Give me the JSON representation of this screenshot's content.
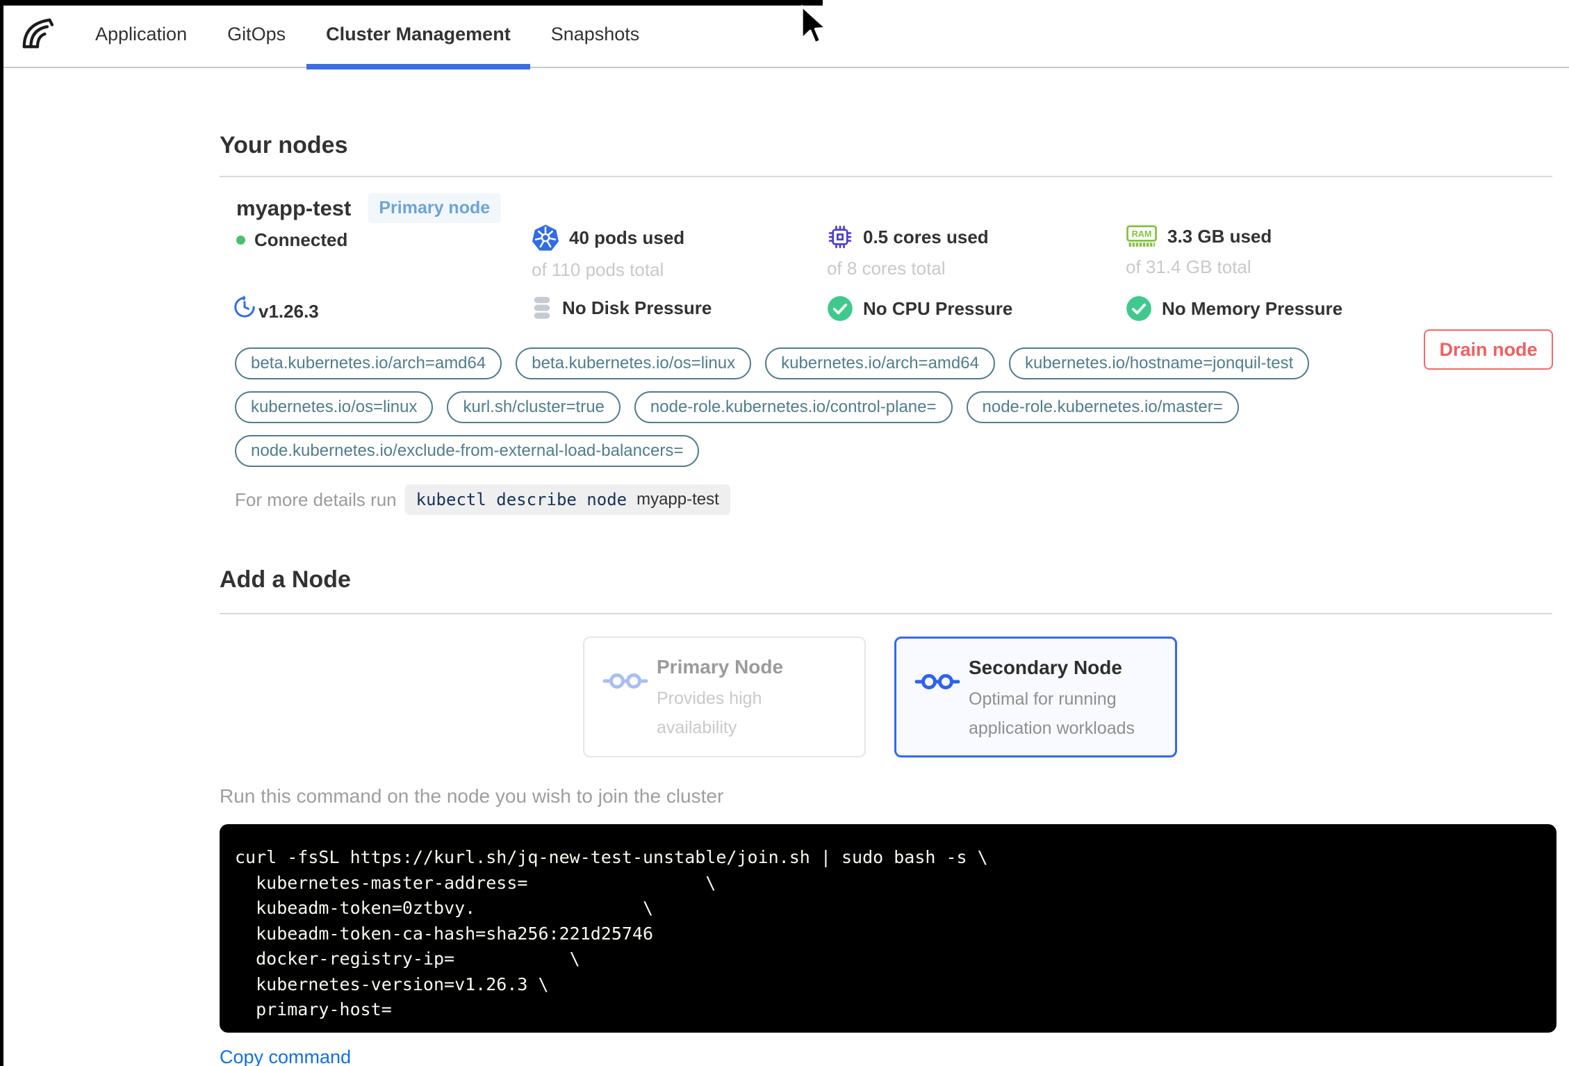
{
  "nav": {
    "tabs": [
      {
        "label": "Application",
        "active": false
      },
      {
        "label": "GitOps",
        "active": false
      },
      {
        "label": "Cluster Management",
        "active": true
      },
      {
        "label": "Snapshots",
        "active": false
      }
    ]
  },
  "nodes": {
    "heading": "Your nodes",
    "node": {
      "name": "myapp-test",
      "badge": "Primary node",
      "status": "Connected",
      "version": "v1.26.3",
      "stats": {
        "pods": {
          "main": "40 pods used",
          "sub": "of 110 pods total"
        },
        "cores": {
          "main": "0.5 cores used",
          "sub": "of 8 cores total"
        },
        "memory": {
          "main": "3.3 GB used",
          "sub": "of 31.4 GB total"
        }
      },
      "conditions": {
        "disk": "No Disk Pressure",
        "cpu": "No CPU Pressure",
        "memory": "No Memory Pressure"
      },
      "labels": [
        "beta.kubernetes.io/arch=amd64",
        "beta.kubernetes.io/os=linux",
        "kubernetes.io/arch=amd64",
        "kubernetes.io/hostname=jonquil-test",
        "kubernetes.io/os=linux",
        "kurl.sh/cluster=true",
        "node-role.kubernetes.io/control-plane=",
        "node-role.kubernetes.io/master=",
        "node.kubernetes.io/exclude-from-external-load-balancers="
      ],
      "drain_label": "Drain node",
      "details_prefix": "For more details run",
      "details_cmd": "kubectl describe node",
      "details_node": "myapp-test"
    }
  },
  "add_node": {
    "heading": "Add a Node",
    "cards": [
      {
        "title": "Primary Node",
        "desc_line1": "Provides high",
        "desc_line2": "availability",
        "selected": false
      },
      {
        "title": "Secondary Node",
        "desc_line1": "Optimal for running",
        "desc_line2": "application workloads",
        "selected": true
      }
    ],
    "instruction": "Run this command on the node you wish to join the cluster",
    "code_lines": [
      "curl -fsSL https://kurl.sh/jq-new-test-unstable/join.sh | sudo bash -s \\",
      "  kubernetes-master-address=                 \\",
      "  kubeadm-token=0ztbvy.                \\",
      "  kubeadm-token-ca-hash=sha256:221d25746",
      "  docker-registry-ip=           \\",
      "  kubernetes-version=v1.26.3 \\",
      "  primary-host="
    ],
    "copy_label": "Copy command"
  },
  "colors": {
    "active_tab_underline": "#3d6de2",
    "badge_bg": "#f2f7fc",
    "badge_text": "#6ba4d8",
    "connected_green": "#4ac06b",
    "check_green": "#3fc98c",
    "kubernetes_blue": "#326ce5",
    "cpu_indigo": "#4a3ecf",
    "ram_green": "#84c341",
    "disk_grey": "#c6cbd1",
    "tag_teal": "#507d8d",
    "drain_red": "#f25f5f",
    "secondary_card_border": "#3268f2",
    "code_bg": "#000000",
    "copy_link_blue": "#1071e5"
  }
}
